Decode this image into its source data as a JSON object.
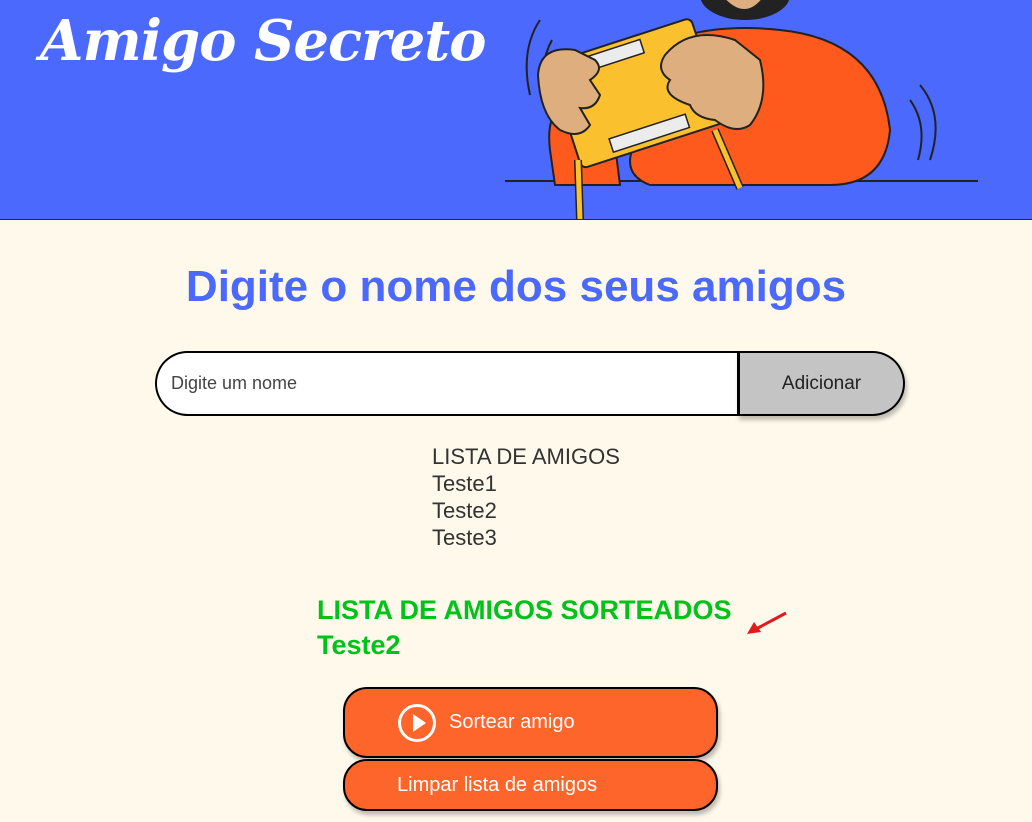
{
  "header": {
    "title": "Amigo Secreto"
  },
  "main": {
    "section_title": "Digite o nome dos seus amigos",
    "input": {
      "placeholder": "Digite um nome",
      "value": ""
    },
    "add_button_label": "Adicionar",
    "friends_heading": "LISTA DE AMIGOS",
    "friends": [
      "Teste1",
      "Teste2",
      "Teste3"
    ],
    "result_heading": "LISTA DE AMIGOS SORTEADOS",
    "results": [
      "Teste2"
    ],
    "draw_button_label": "Sortear amigo",
    "clear_button_label": "Limpar lista de amigos"
  },
  "icons": {
    "draw_button_icon": "play-circle-icon",
    "annotation": "red-arrow-icon"
  },
  "colors": {
    "header_bg": "#4b69fd",
    "page_bg": "#fff9eb",
    "accent_blue": "#4b69fd",
    "button_orange": "#fe652b",
    "result_green": "#00c21a"
  }
}
